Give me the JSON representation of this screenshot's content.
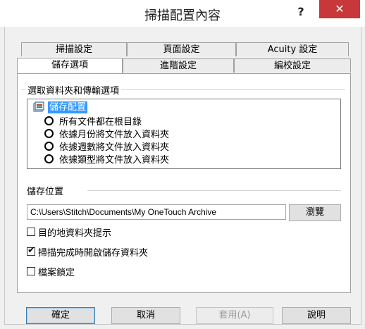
{
  "window": {
    "title": "掃描配置內容",
    "help_label": "?",
    "close_label": "✕"
  },
  "tabs": {
    "row_back": [
      {
        "label": "掃描設定"
      },
      {
        "label": "頁面設定"
      },
      {
        "label": "Acuity 設定"
      }
    ],
    "row_front": [
      {
        "label": "儲存選項",
        "active": true
      },
      {
        "label": "進階設定"
      },
      {
        "label": "編校設定"
      }
    ]
  },
  "folder_group": {
    "label": "選取資料夾和傳輸選項",
    "root_label": "儲存配置",
    "options": [
      {
        "label": "所有文件都在根目錄"
      },
      {
        "label": "依據月份將文件放入資料夾"
      },
      {
        "label": "依據週數將文件放入資料夾"
      },
      {
        "label": "依據類型將文件放入資料夾"
      }
    ]
  },
  "location_group": {
    "label": "儲存位置",
    "path_value": "C:\\Users\\Stitch\\Documents\\My OneTouch Archive",
    "browse_label": "瀏覽"
  },
  "checkboxes": [
    {
      "label": "目的地資料夾提示",
      "checked": false
    },
    {
      "label": "掃描完成時開啟儲存資料夾",
      "checked": true
    },
    {
      "label": "檔案鎖定",
      "checked": false
    }
  ],
  "buttons": {
    "ok": "確定",
    "cancel": "取消",
    "apply": "套用(A)",
    "help": "說明"
  },
  "colors": {
    "close": "#c8383a",
    "selection": "#3399ff"
  }
}
